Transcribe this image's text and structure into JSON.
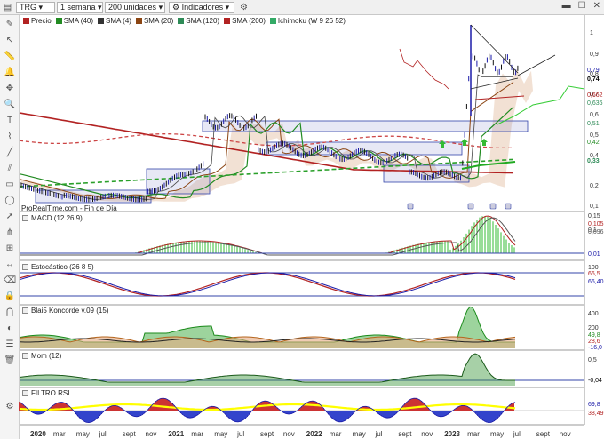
{
  "toolbar": {
    "symbol": "TRG",
    "period": "1 semana",
    "units": "200 unidades",
    "indicators": "Indicadores"
  },
  "legend": [
    {
      "label": "Precio",
      "color": "#b22222"
    },
    {
      "label": "SMA (40)",
      "color": "#228b22"
    },
    {
      "label": "SMA (4)",
      "color": "#333333"
    },
    {
      "label": "SMA (20)",
      "color": "#8b4513"
    },
    {
      "label": "SMA (120)",
      "color": "#2e8b57"
    },
    {
      "label": "SMA (200)",
      "color": "#b22222"
    },
    {
      "label": "Ichimoku (W 9 26 52)",
      "color": "#3a6"
    }
  ],
  "main_footer": "ProRealTime.com - Fin de Día",
  "main_axis": [
    "1",
    "0,9",
    "0,8",
    "0,7",
    "0,6",
    "0,5",
    "0,4",
    "0,3",
    "0,2",
    "0,1"
  ],
  "main_values": [
    {
      "text": "0,79",
      "color": "#1a1aa8"
    },
    {
      "text": "0,74",
      "color": "#000000"
    },
    {
      "text": "0,662",
      "color": "#b22222"
    },
    {
      "text": "0,636",
      "color": "#2e8b57"
    },
    {
      "text": "0,51",
      "color": "#2e8b57"
    },
    {
      "text": "0,42",
      "color": "#228b22"
    },
    {
      "text": "0,33",
      "color": "#2e8b57"
    }
  ],
  "panes": [
    {
      "label": "MACD (12 26 9)",
      "axis": [
        "0,15",
        "0,1"
      ],
      "values": [
        "0,105",
        "0,096",
        "0,01"
      ]
    },
    {
      "label": "Estocástico (26 8 5)",
      "axis": [
        "100"
      ],
      "values": [
        "66,5",
        "66,40"
      ]
    },
    {
      "label": "Blai5 Koncorde v.09 (15)",
      "axis": [
        "400",
        "200"
      ],
      "values": [
        "49,8",
        "28,6",
        "-16,0"
      ]
    },
    {
      "label": "Mom (12)",
      "axis": [
        "0,5"
      ],
      "values": [
        "-0,04"
      ]
    },
    {
      "label": "FILTRO RSI",
      "axis": [],
      "values": [
        "69,8",
        "38,49"
      ]
    }
  ],
  "x_axis": [
    {
      "t": "2020",
      "bold": true
    },
    {
      "t": "mar"
    },
    {
      "t": "may"
    },
    {
      "t": "jul"
    },
    {
      "t": "sept"
    },
    {
      "t": "nov"
    },
    {
      "t": "2021",
      "bold": true
    },
    {
      "t": "mar"
    },
    {
      "t": "may"
    },
    {
      "t": "jul"
    },
    {
      "t": "sept"
    },
    {
      "t": "nov"
    },
    {
      "t": "2022",
      "bold": true
    },
    {
      "t": "mar"
    },
    {
      "t": "may"
    },
    {
      "t": "jul"
    },
    {
      "t": "sept"
    },
    {
      "t": "nov"
    },
    {
      "t": "2023",
      "bold": true
    },
    {
      "t": "mar"
    },
    {
      "t": "may"
    },
    {
      "t": "jul"
    },
    {
      "t": "sept"
    },
    {
      "t": "nov"
    }
  ]
}
